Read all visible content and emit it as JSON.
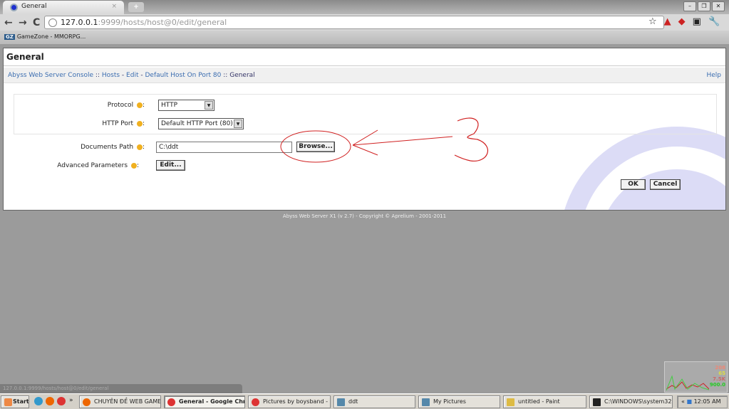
{
  "browser": {
    "tab_title": "General",
    "url_host": "127.0.0.1",
    "url_rest": ":9999/hosts/host@0/edit/general",
    "bookmark": "GameZone - MMORPG...",
    "bookmark_icon": "GZ"
  },
  "page": {
    "title": "General",
    "breadcrumb": [
      "Abyss Web Server Console",
      "Hosts",
      "Edit",
      "Default Host On Port 80",
      "General"
    ],
    "breadcrumb_sep": "::",
    "breadcrumb_dash": "-",
    "help": "Help",
    "fields": {
      "protocol": {
        "label": "Protocol",
        "value": "HTTP"
      },
      "port": {
        "label": "HTTP Port",
        "value": "Default HTTP Port (80)"
      },
      "docpath": {
        "label": "Documents Path",
        "value": "C:\\ddt",
        "button": "Browse..."
      },
      "advanced": {
        "label": "Advanced Parameters",
        "button": "Edit..."
      }
    },
    "colon": ":",
    "ok": "OK",
    "cancel": "Cancel",
    "footer": "Abyss Web Server X1 (v 2.7) - Copyright © Aprelium - 2001-2011"
  },
  "annotation": {
    "label": "3",
    "color": "#d02020"
  },
  "status_url": "127.0.0.1:9999/hosts/host@0/edit/general",
  "taskbar": {
    "start": "Start",
    "chevron": "»",
    "items": [
      "CHUYÊN ĐỀ WEB GAME...",
      "General - Google Chr...",
      "Pictures by boysband - ...",
      "ddt",
      "My Pictures",
      "untitled - Paint",
      "C:\\WINDOWS\\system32..."
    ],
    "clock": "12:05 AM",
    "meter": [
      "208",
      "65",
      "7.5K",
      "900.0"
    ]
  }
}
